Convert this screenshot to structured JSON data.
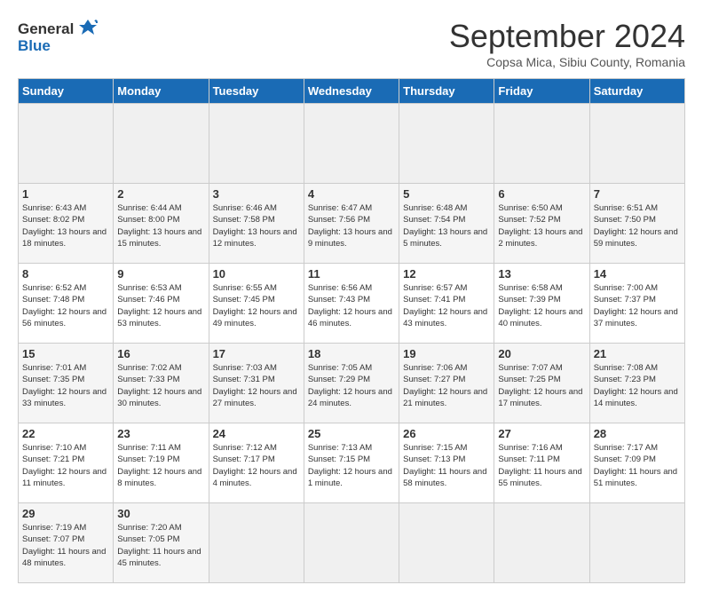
{
  "header": {
    "logo_general": "General",
    "logo_blue": "Blue",
    "month_title": "September 2024",
    "location": "Copsa Mica, Sibiu County, Romania"
  },
  "calendar": {
    "headers": [
      "Sunday",
      "Monday",
      "Tuesday",
      "Wednesday",
      "Thursday",
      "Friday",
      "Saturday"
    ],
    "weeks": [
      [
        {
          "day": null
        },
        {
          "day": null
        },
        {
          "day": null
        },
        {
          "day": null
        },
        {
          "day": null
        },
        {
          "day": null
        },
        {
          "day": null
        }
      ],
      [
        {
          "day": 1,
          "sunrise": "6:43 AM",
          "sunset": "8:02 PM",
          "daylight": "13 hours and 18 minutes"
        },
        {
          "day": 2,
          "sunrise": "6:44 AM",
          "sunset": "8:00 PM",
          "daylight": "13 hours and 15 minutes"
        },
        {
          "day": 3,
          "sunrise": "6:46 AM",
          "sunset": "7:58 PM",
          "daylight": "13 hours and 12 minutes"
        },
        {
          "day": 4,
          "sunrise": "6:47 AM",
          "sunset": "7:56 PM",
          "daylight": "13 hours and 9 minutes"
        },
        {
          "day": 5,
          "sunrise": "6:48 AM",
          "sunset": "7:54 PM",
          "daylight": "13 hours and 5 minutes"
        },
        {
          "day": 6,
          "sunrise": "6:50 AM",
          "sunset": "7:52 PM",
          "daylight": "13 hours and 2 minutes"
        },
        {
          "day": 7,
          "sunrise": "6:51 AM",
          "sunset": "7:50 PM",
          "daylight": "12 hours and 59 minutes"
        }
      ],
      [
        {
          "day": 8,
          "sunrise": "6:52 AM",
          "sunset": "7:48 PM",
          "daylight": "12 hours and 56 minutes"
        },
        {
          "day": 9,
          "sunrise": "6:53 AM",
          "sunset": "7:46 PM",
          "daylight": "12 hours and 53 minutes"
        },
        {
          "day": 10,
          "sunrise": "6:55 AM",
          "sunset": "7:45 PM",
          "daylight": "12 hours and 49 minutes"
        },
        {
          "day": 11,
          "sunrise": "6:56 AM",
          "sunset": "7:43 PM",
          "daylight": "12 hours and 46 minutes"
        },
        {
          "day": 12,
          "sunrise": "6:57 AM",
          "sunset": "7:41 PM",
          "daylight": "12 hours and 43 minutes"
        },
        {
          "day": 13,
          "sunrise": "6:58 AM",
          "sunset": "7:39 PM",
          "daylight": "12 hours and 40 minutes"
        },
        {
          "day": 14,
          "sunrise": "7:00 AM",
          "sunset": "7:37 PM",
          "daylight": "12 hours and 37 minutes"
        }
      ],
      [
        {
          "day": 15,
          "sunrise": "7:01 AM",
          "sunset": "7:35 PM",
          "daylight": "12 hours and 33 minutes"
        },
        {
          "day": 16,
          "sunrise": "7:02 AM",
          "sunset": "7:33 PM",
          "daylight": "12 hours and 30 minutes"
        },
        {
          "day": 17,
          "sunrise": "7:03 AM",
          "sunset": "7:31 PM",
          "daylight": "12 hours and 27 minutes"
        },
        {
          "day": 18,
          "sunrise": "7:05 AM",
          "sunset": "7:29 PM",
          "daylight": "12 hours and 24 minutes"
        },
        {
          "day": 19,
          "sunrise": "7:06 AM",
          "sunset": "7:27 PM",
          "daylight": "12 hours and 21 minutes"
        },
        {
          "day": 20,
          "sunrise": "7:07 AM",
          "sunset": "7:25 PM",
          "daylight": "12 hours and 17 minutes"
        },
        {
          "day": 21,
          "sunrise": "7:08 AM",
          "sunset": "7:23 PM",
          "daylight": "12 hours and 14 minutes"
        }
      ],
      [
        {
          "day": 22,
          "sunrise": "7:10 AM",
          "sunset": "7:21 PM",
          "daylight": "12 hours and 11 minutes"
        },
        {
          "day": 23,
          "sunrise": "7:11 AM",
          "sunset": "7:19 PM",
          "daylight": "12 hours and 8 minutes"
        },
        {
          "day": 24,
          "sunrise": "7:12 AM",
          "sunset": "7:17 PM",
          "daylight": "12 hours and 4 minutes"
        },
        {
          "day": 25,
          "sunrise": "7:13 AM",
          "sunset": "7:15 PM",
          "daylight": "12 hours and 1 minute"
        },
        {
          "day": 26,
          "sunrise": "7:15 AM",
          "sunset": "7:13 PM",
          "daylight": "11 hours and 58 minutes"
        },
        {
          "day": 27,
          "sunrise": "7:16 AM",
          "sunset": "7:11 PM",
          "daylight": "11 hours and 55 minutes"
        },
        {
          "day": 28,
          "sunrise": "7:17 AM",
          "sunset": "7:09 PM",
          "daylight": "11 hours and 51 minutes"
        }
      ],
      [
        {
          "day": 29,
          "sunrise": "7:19 AM",
          "sunset": "7:07 PM",
          "daylight": "11 hours and 48 minutes"
        },
        {
          "day": 30,
          "sunrise": "7:20 AM",
          "sunset": "7:05 PM",
          "daylight": "11 hours and 45 minutes"
        },
        null,
        null,
        null,
        null,
        null
      ]
    ]
  }
}
